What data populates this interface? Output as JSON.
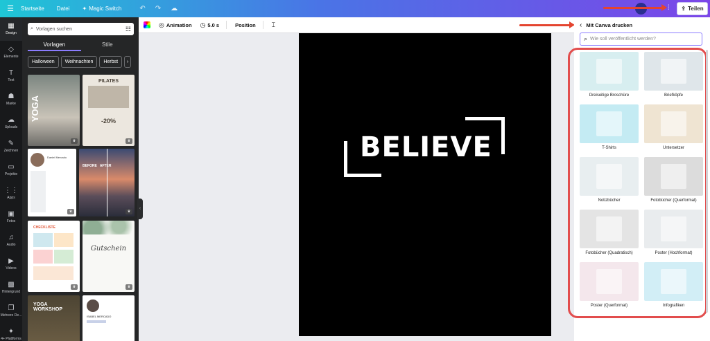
{
  "topbar": {
    "menu_icon": "hamburger-icon",
    "home": "Startseite",
    "file": "Datei",
    "magic": "Magic Switch",
    "share": "Teilen"
  },
  "rail": [
    {
      "label": "Design",
      "icon": "▦"
    },
    {
      "label": "Elemente",
      "icon": "◇"
    },
    {
      "label": "Text",
      "icon": "T"
    },
    {
      "label": "Marke",
      "icon": "☗"
    },
    {
      "label": "Uploads",
      "icon": "☁"
    },
    {
      "label": "Zeichnen",
      "icon": "✎"
    },
    {
      "label": "Projekte",
      "icon": "▭"
    },
    {
      "label": "Apps",
      "icon": "⋮⋮"
    },
    {
      "label": "Fotos",
      "icon": "▣"
    },
    {
      "label": "Audio",
      "icon": "♫"
    },
    {
      "label": "Videos",
      "icon": "▶"
    },
    {
      "label": "Hintergrund",
      "icon": "▩"
    },
    {
      "label": "Mehrere De...",
      "icon": "❐"
    },
    {
      "label": "4+ Plattforms",
      "icon": "✦"
    }
  ],
  "panel": {
    "search_placeholder": "Vorlagen suchen",
    "tab_templates": "Vorlagen",
    "tab_styles": "Stile",
    "chips": [
      "Halloween",
      "Weihnachten",
      "Herbst",
      "›"
    ],
    "templates": [
      {
        "name": "template-yoga-poster",
        "text": "YOGA"
      },
      {
        "name": "template-pilates-flyer",
        "text": "PILATES",
        "sub": "-20%"
      },
      {
        "name": "template-resume",
        "text": "Daniel Mercado"
      },
      {
        "name": "template-pier-before-after",
        "text": "BEFORE   AFTER"
      },
      {
        "name": "template-checklist",
        "text": "CHECKLISTE"
      },
      {
        "name": "template-gutschein",
        "text": "Gutschein"
      },
      {
        "name": "template-yoga-workshop",
        "text": "YOGA WORKSHOP"
      },
      {
        "name": "template-cv-isabel",
        "text": "ISABEL MERCADO"
      }
    ]
  },
  "toolbar": {
    "animation": "Animation",
    "duration": "5.0 s",
    "position": "Position"
  },
  "canvas": {
    "word": "BELIEVE"
  },
  "right_panel": {
    "title": "Mit Canva drucken",
    "search_placeholder": "Wie soll veröffentlicht werden?",
    "products": [
      {
        "label": "Dreiseitige Broschüre",
        "color": "#d7eef0"
      },
      {
        "label": "Briefköpfe",
        "color": "#dfe6ea"
      },
      {
        "label": "T-Shirts",
        "color": "#c4ebf3"
      },
      {
        "label": "Untersetzer",
        "color": "#efe4d2"
      },
      {
        "label": "Notizbücher",
        "color": "#e8eef0"
      },
      {
        "label": "Fotobücher (Querformat)",
        "color": "#dcdcdc"
      },
      {
        "label": "Fotobücher (Quadratisch)",
        "color": "#e4e4e4"
      },
      {
        "label": "Poster (Hochformat)",
        "color": "#e9ecee"
      },
      {
        "label": "Poster (Querformat)",
        "color": "#f4e7ec"
      },
      {
        "label": "Infografiken",
        "color": "#d2eef6"
      }
    ]
  }
}
